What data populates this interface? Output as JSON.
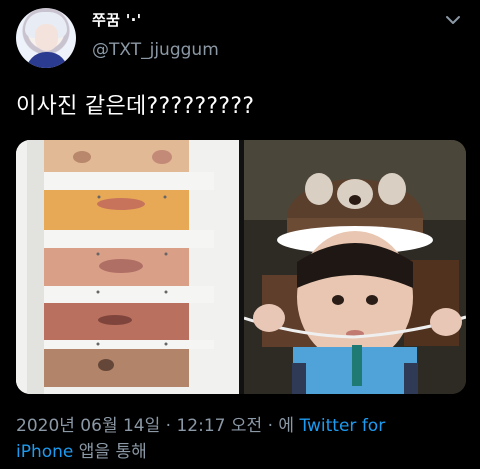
{
  "author": {
    "display_name": "쭈꿈 '·'",
    "handle": "@TXT_jjuggum"
  },
  "tweet": {
    "text": "이사진 같은데?????????"
  },
  "footer": {
    "date": "2020년 06월 14일",
    "separator": " · ",
    "time": "12:17 오전",
    "via": " · 에 ",
    "client_line1": "Twitter for",
    "client_line2": "iPhone",
    "suffix": " 앱을 통해"
  },
  "icons": {
    "more": "chevron-down-icon"
  }
}
